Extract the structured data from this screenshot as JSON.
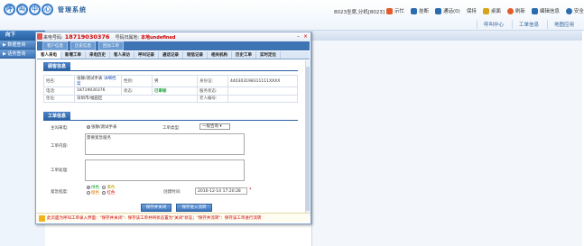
{
  "app": {
    "logo_chars": [
      "呼",
      "叫",
      "中",
      "心"
    ],
    "title": "管理系统"
  },
  "header": {
    "user_info": "8023坐席,分机[8023]",
    "toolbar": [
      {
        "label": "示忙",
        "icon": "busy-icon",
        "color": "#e25b2a"
      },
      {
        "label": "挂断",
        "icon": "hangup-icon",
        "color": "#2b6cb0"
      },
      {
        "label": "通话(0)",
        "icon": "call-icon",
        "color": "#2b6cb0"
      },
      {
        "label": "保持",
        "icon": "hold-icon",
        "color": "#888888"
      },
      {
        "label": "桌面",
        "icon": "desktop-icon",
        "color": "#d9a21b"
      },
      {
        "label": "刷新",
        "icon": "refresh-icon",
        "color": "#e25b2a"
      },
      {
        "label": "编辑信息",
        "icon": "edit-icon",
        "color": "#2b6cb0"
      },
      {
        "label": "安全退出",
        "icon": "logout-icon",
        "color": "#2b6cb0"
      }
    ],
    "subnav": [
      "呼叫中心",
      "工单信息",
      "地图应用"
    ]
  },
  "sidebar": {
    "head": "向下",
    "items": [
      "▶ 数据查询",
      "▶ 话务查询"
    ]
  },
  "dialog": {
    "caller_label": "来电号码:",
    "caller_number": "18719030376",
    "region_label": "号码归属地:",
    "region_value": "本地undefined",
    "subtabs": [
      "客户信息",
      "历史信息",
      "回访工单"
    ],
    "tabs": [
      "客人来电",
      "新增工单",
      "来电历史",
      "客人来访",
      "呼叫记录",
      "通话记录",
      "短信记录",
      "相关机构",
      "历史工单",
      "实时定位"
    ],
    "client_section": "顾客信息",
    "client": {
      "name_label": "姓名:",
      "name_value": "张静/测试手表",
      "name_link": "详细档案",
      "gender_label": "性别:",
      "gender_value": "男",
      "id_label": "身份证:",
      "id_value": "440303198311111XXXX",
      "phone_label": "电话:",
      "phone_value": "18719030376",
      "status_label": "状态:",
      "status_value": "已审核",
      "service_label": "服务状态:",
      "service_value": "",
      "address_label": "住址:",
      "address_value": "深圳市/福田区",
      "owner_label": "老人编号:",
      "owner_value": ""
    },
    "work_section": "工单信息",
    "work": {
      "subject_label": "主叫来电:",
      "subject_value": "张静/测试手表",
      "type_label": "工单类型:",
      "type_value": "一般咨询",
      "content_label": "工单内容:",
      "content_value": "需要紧急服务",
      "result_label": "工单处理:",
      "result_value": "",
      "level_label": "紧急程度:",
      "levels": [
        "绿色",
        "黄色",
        "橙色",
        "红色"
      ],
      "time_label": "创建时间:",
      "time_value": "2016-12-14 17:20:28",
      "close_btn": "保存并关闭",
      "transfer_btn": "保存进入流转"
    },
    "notice": "此页面为呼叫工单录入界面：\"保存并关闭\"：保存该工单并将状态置为\"关闭\"状态；\"保存并流转\"：保存该工单进行流转"
  }
}
